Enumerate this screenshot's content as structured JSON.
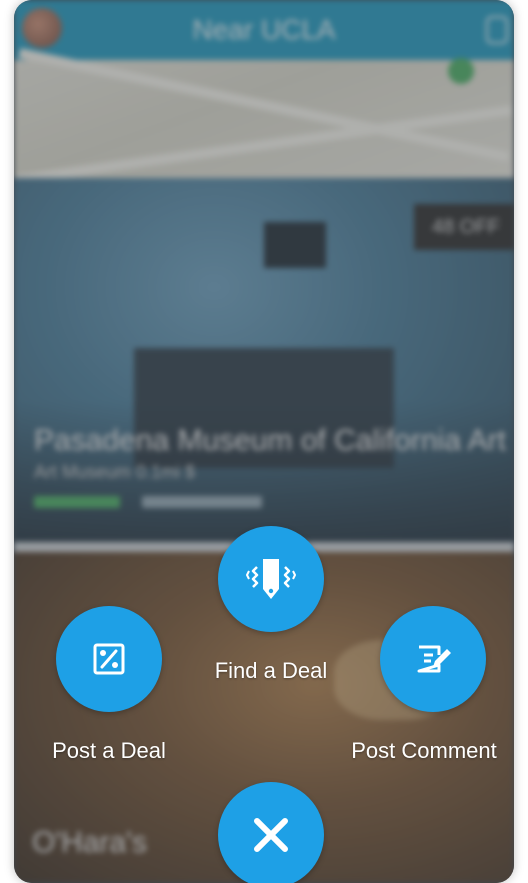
{
  "header": {
    "title": "Near UCLA"
  },
  "cards": [
    {
      "title": "Pasadena Museum of California Art",
      "subtitle": "Art Museum 0.1mi $",
      "badge": "48 OFF"
    },
    {
      "title": "O'Hara's"
    }
  ],
  "action_menu": {
    "find_deal_label": "Find a Deal",
    "post_deal_label": "Post a Deal",
    "post_comment_label": "Post Comment"
  },
  "colors": {
    "accent": "#1ea0e6",
    "header": "#0d8fb8"
  },
  "icons": {
    "find_deal": "vibrating-tag-icon",
    "post_deal": "percent-icon",
    "post_comment": "edit-note-icon",
    "close": "close-icon"
  }
}
